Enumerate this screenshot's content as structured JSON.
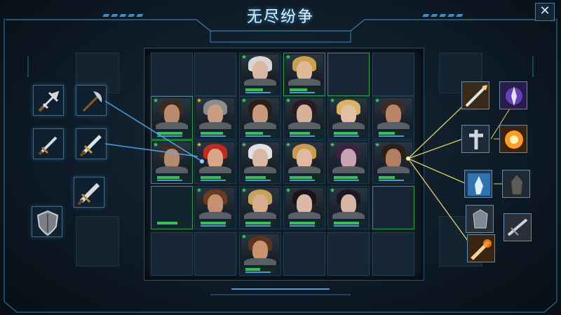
{
  "header": {
    "title": "无尽纷争",
    "close_label": "✕"
  },
  "colors": {
    "accent": "#3aa6ff",
    "hp_bar": "#35c255",
    "link_blue": "#4fb3ff",
    "link_gold": "#e0cf6a"
  },
  "left_equipment": [
    {
      "name": "dagger-icon"
    },
    {
      "name": "axe-icon"
    },
    {
      "name": "short-sword-icon"
    },
    {
      "name": "sword-icon"
    },
    {
      "name": "broadsword-icon"
    },
    {
      "name": "shield-icon"
    }
  ],
  "right_skills": [
    {
      "name": "spear-strike-icon"
    },
    {
      "name": "arcane-burst-icon"
    },
    {
      "name": "cross-totem-icon"
    },
    {
      "name": "fire-explosion-icon"
    },
    {
      "name": "frost-summon-icon"
    },
    {
      "name": "shadow-warrior-icon"
    },
    {
      "name": "dark-armor-icon"
    },
    {
      "name": "blade-icon"
    },
    {
      "name": "fire-strike-icon"
    }
  ],
  "heroes": [
    {
      "hair": "#d8d6d2",
      "skin": "#d9b8a1",
      "hp": 0.6
    },
    {
      "hair": "#caa04e",
      "skin": "#e0b89a",
      "hp": 0.6
    },
    {
      "hair": "#3a2a20",
      "skin": "#b98b6c",
      "hp": 0.85
    },
    {
      "hair": "#8c8c8c",
      "skin": "#c99d82",
      "hp": 0.75
    },
    {
      "hair": "#2a1d16",
      "skin": "#c69a7c",
      "hp": 0.6
    },
    {
      "hair": "#2b1a22",
      "skin": "#d7b29a",
      "hp": 0.7
    },
    {
      "hair": "#d9b460",
      "skin": "#e2bfa4",
      "hp": 0.8
    },
    {
      "hair": "#3c2c24",
      "skin": "#b88568",
      "hp": 0.55
    },
    {
      "hair": "#3b2d24",
      "skin": "#b58a6e",
      "hp": 0.75
    },
    {
      "hair": "#c12a22",
      "skin": "#d8a686",
      "hp": 0.7
    },
    {
      "hair": "#e1e0e4",
      "skin": "#dab7a3",
      "hp": 0.7
    },
    {
      "hair": "#c89c50",
      "skin": "#e2b99e",
      "hp": 0.75
    },
    {
      "hair": "#3a2340",
      "skin": "#c9a2b4",
      "hp": 0.8
    },
    {
      "hair": "#2a2019",
      "skin": "#b27f62",
      "hp": 0.55
    },
    {
      "hair": "#6b3a22",
      "skin": "#c6906e",
      "hp": 0.85
    },
    {
      "hair": "#c4a45a",
      "skin": "#d8ad8c",
      "hp": 0.85
    },
    {
      "hair": "#1c1418",
      "skin": "#dcb8a6",
      "hp": 0.85
    },
    {
      "hair": "#1e1620",
      "skin": "#d7b4a4",
      "hp": 0.85
    },
    {
      "hair": "#5c3322",
      "skin": "#c8926e",
      "hp": 0.5
    }
  ],
  "empty_slot_hp": 0.7
}
